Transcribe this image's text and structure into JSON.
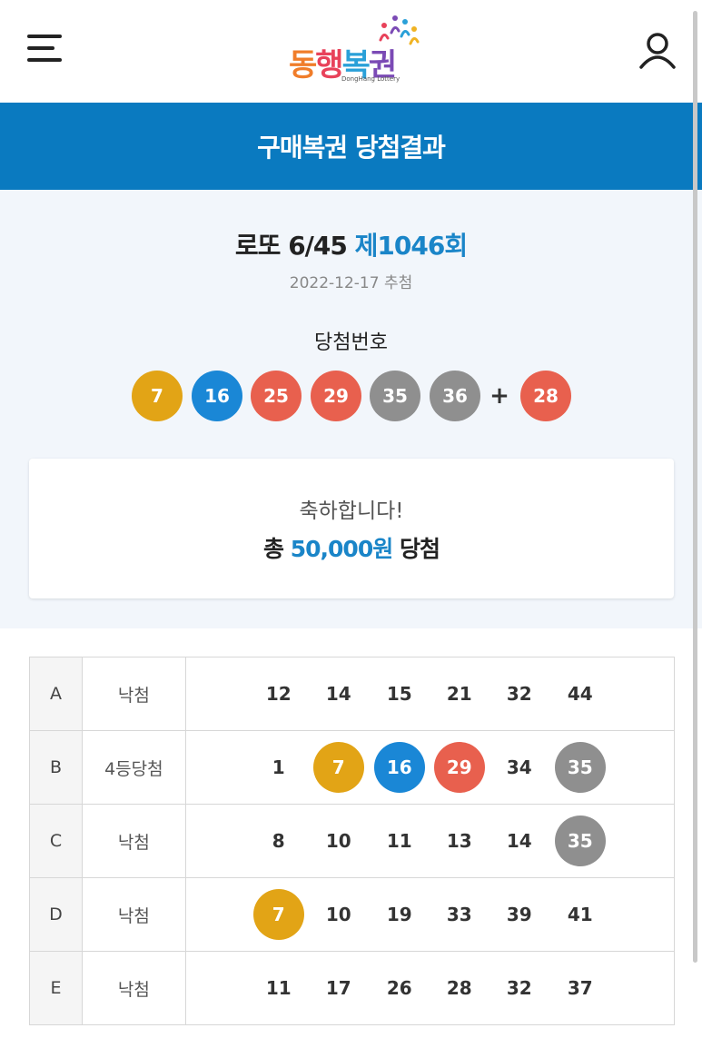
{
  "header": {
    "logo_text_parts": [
      "동",
      "행",
      "복",
      "권"
    ],
    "logo_sub": "DongHang Lottery",
    "menu_icon": "hamburger-menu-icon",
    "user_icon": "user-icon"
  },
  "banner": {
    "title": "구매복권 당첨결과"
  },
  "draw": {
    "game_name": "로또 6/45",
    "round": "제1046회",
    "date": "2022-12-17 추첨",
    "numbers_label": "당첨번호",
    "numbers": [
      7,
      16,
      25,
      29,
      35,
      36
    ],
    "plus": "+",
    "bonus": 28
  },
  "congrats": {
    "message": "축하합니다!",
    "prefix": "총",
    "amount": "50,000원",
    "suffix": "당첨"
  },
  "ball_colors": {
    "1-10": "#e2a416",
    "11-20": "#1a87d6",
    "21-30": "#e8604e",
    "31-40": "#8f8f8f",
    "41-45": "#6db33f"
  },
  "tickets": [
    {
      "game": "A",
      "result": "낙첨",
      "numbers": [
        12,
        14,
        15,
        21,
        32,
        44
      ],
      "hits": [
        false,
        false,
        false,
        false,
        false,
        false
      ]
    },
    {
      "game": "B",
      "result": "4등당첨",
      "numbers": [
        1,
        7,
        16,
        29,
        34,
        35
      ],
      "hits": [
        false,
        true,
        true,
        true,
        false,
        true
      ]
    },
    {
      "game": "C",
      "result": "낙첨",
      "numbers": [
        8,
        10,
        11,
        13,
        14,
        35
      ],
      "hits": [
        false,
        false,
        false,
        false,
        false,
        true
      ]
    },
    {
      "game": "D",
      "result": "낙첨",
      "numbers": [
        7,
        10,
        19,
        33,
        39,
        41
      ],
      "hits": [
        true,
        false,
        false,
        false,
        false,
        false
      ]
    },
    {
      "game": "E",
      "result": "낙첨",
      "numbers": [
        11,
        17,
        26,
        28,
        32,
        37
      ],
      "hits": [
        false,
        false,
        false,
        false,
        false,
        false
      ]
    }
  ]
}
